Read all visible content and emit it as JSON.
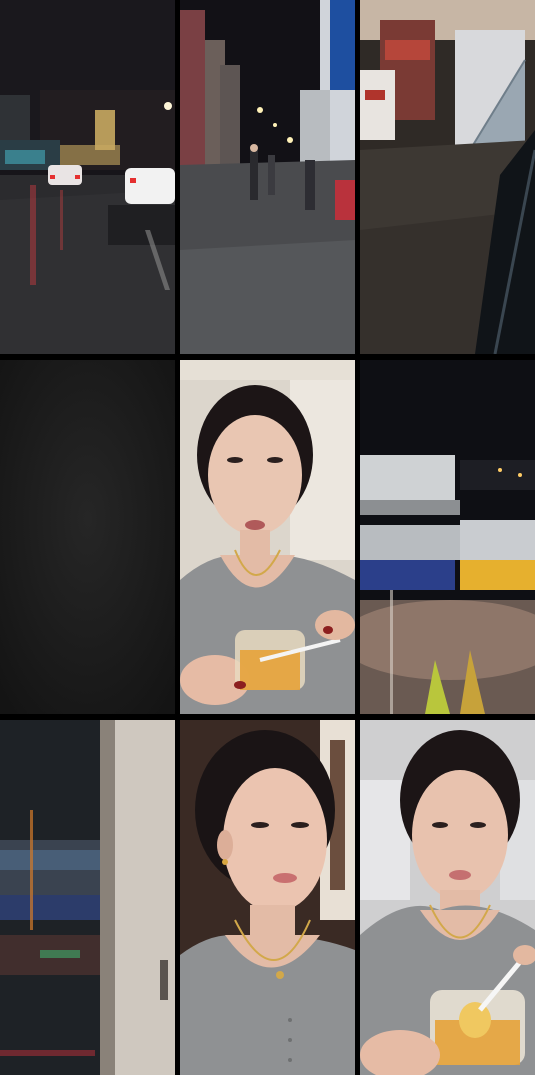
{
  "tiles": [
    {
      "scene": "night-street-traffic",
      "name": "tile-night-street-traffic"
    },
    {
      "scene": "night-street-pedestrians",
      "name": "tile-night-street-pedestrians"
    },
    {
      "scene": "shop-staircase-sidewalk",
      "name": "tile-shop-staircase-sidewalk"
    },
    {
      "scene": "dark-frame",
      "name": "tile-dark-frame"
    },
    {
      "scene": "woman-eating-dessert",
      "name": "tile-woman-eating-dessert"
    },
    {
      "scene": "night-buildings-view",
      "name": "tile-night-buildings-view"
    },
    {
      "scene": "window-reflection-street",
      "name": "tile-window-reflection-street"
    },
    {
      "scene": "woman-closeup",
      "name": "tile-woman-closeup"
    },
    {
      "scene": "woman-holding-cup",
      "name": "tile-woman-holding-cup"
    }
  ],
  "colors": {
    "grid_background": "#000000",
    "night_sky": "#141218",
    "asphalt": "#3a3a3e",
    "skin": "#e8c2ae",
    "shirt_gray": "#8f9193",
    "hair": "#1c1516",
    "dessert_orange": "#e6a23a"
  }
}
